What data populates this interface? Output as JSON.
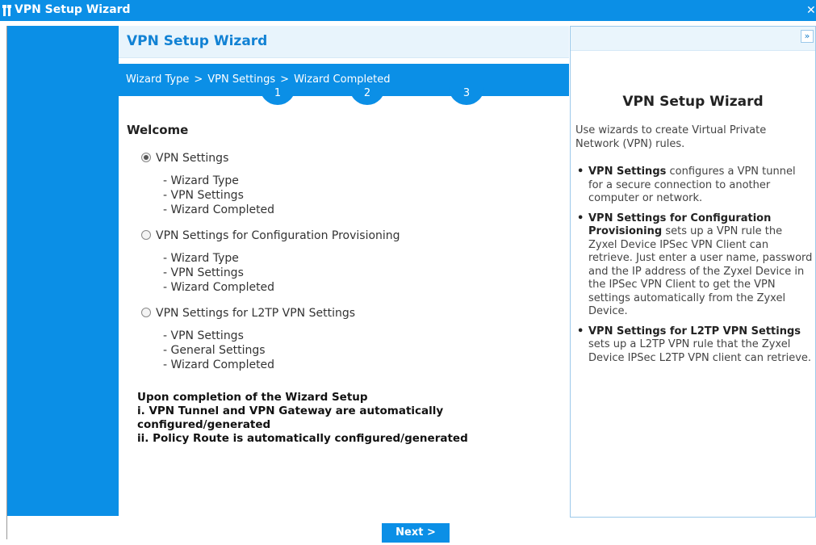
{
  "window": {
    "title": "VPN Setup Wizard",
    "close_icon": "close-icon"
  },
  "header": {
    "title": "VPN Setup Wizard"
  },
  "steps": {
    "labels": [
      "Wizard Type",
      "VPN Settings",
      "Wizard Completed"
    ],
    "numbers": [
      "1",
      "2",
      "3"
    ],
    "separator": ">"
  },
  "main": {
    "welcome": "Welcome",
    "options": [
      {
        "label": "VPN Settings",
        "checked": true,
        "items": [
          "- Wizard Type",
          "- VPN Settings",
          "- Wizard Completed"
        ]
      },
      {
        "label": "VPN Settings for Configuration Provisioning",
        "checked": false,
        "items": [
          "- Wizard Type",
          "- VPN Settings",
          "- Wizard Completed"
        ]
      },
      {
        "label": "VPN Settings for L2TP VPN Settings",
        "checked": false,
        "items": [
          "- VPN Settings",
          "- General Settings",
          "- Wizard Completed"
        ]
      }
    ],
    "completion": [
      "Upon completion of the Wizard Setup",
      "i. VPN Tunnel and VPN Gateway are automatically configured/generated",
      "ii. Policy Route is automatically configured/generated"
    ]
  },
  "footer": {
    "next_label": "Next >"
  },
  "help": {
    "collapse_label": "»",
    "title": "VPN Setup Wizard",
    "intro": "Use wizards to create Virtual Private Network (VPN) rules.",
    "bullets": [
      {
        "bold": "VPN Settings",
        "text": " configures a VPN tunnel for a secure connection to another computer or network."
      },
      {
        "bold": "VPN Settings for Configuration Provisioning",
        "text": " sets up a VPN rule the Zyxel Device IPSec VPN Client can retrieve. Just enter a user name, password and the IP address of the Zyxel Device in the IPSec VPN Client to get the VPN settings automatically from the Zyxel Device."
      },
      {
        "bold": "VPN Settings for L2TP VPN Settings",
        "text": " sets up a L2TP VPN rule that the Zyxel Device IPSec L2TP VPN client can retrieve."
      }
    ]
  },
  "colors": {
    "accent": "#0b8fe6",
    "header_bg": "#e8f4fc",
    "title_text": "#1282d4"
  }
}
